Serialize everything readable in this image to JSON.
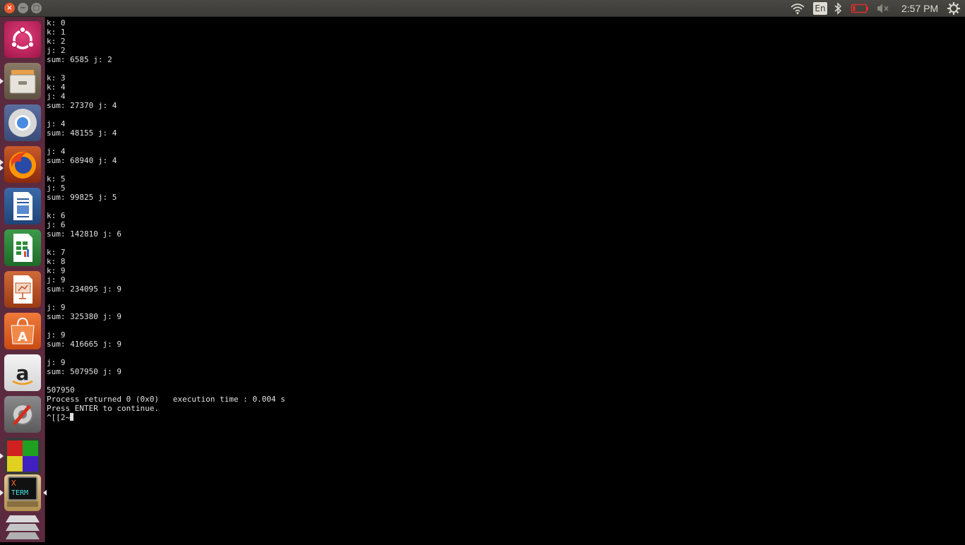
{
  "top_panel": {
    "window_buttons": {
      "close": "×",
      "minimize": "−",
      "maximize": "□"
    },
    "tray": {
      "language": "En",
      "clock": "2:57 PM"
    }
  },
  "launcher": {
    "items": [
      {
        "icon": "ubuntu-dash-icon",
        "color": "#c2185b"
      },
      {
        "icon": "files-icon",
        "color": "#7a6a55"
      },
      {
        "icon": "chromium-icon",
        "color": "#4a7fd6"
      },
      {
        "icon": "firefox-icon",
        "color": "#e66000"
      },
      {
        "icon": "libreoffice-writer-icon",
        "color": "#2a5a9c"
      },
      {
        "icon": "libreoffice-calc-icon",
        "color": "#2e8b3a"
      },
      {
        "icon": "libreoffice-impress-icon",
        "color": "#c0501e"
      },
      {
        "icon": "software-center-icon",
        "color": "#e05a1c"
      },
      {
        "icon": "amazon-icon",
        "color": "#f0f0f0"
      },
      {
        "icon": "system-settings-icon",
        "color": "#9a9a9a"
      },
      {
        "icon": "codeblocks-icon",
        "color": "#6a4aa0"
      },
      {
        "icon": "xterm-icon",
        "color": "#c9b47a"
      },
      {
        "icon": "workspace-switcher-icon",
        "color": "#c8c8c8"
      }
    ]
  },
  "terminal": {
    "lines": [
      "k: 0",
      "k: 1",
      "k: 2",
      "j: 2",
      "sum: 6585 j: 2",
      "",
      "k: 3",
      "k: 4",
      "j: 4",
      "sum: 27370 j: 4",
      "",
      "j: 4",
      "sum: 48155 j: 4",
      "",
      "j: 4",
      "sum: 68940 j: 4",
      "",
      "k: 5",
      "j: 5",
      "sum: 99825 j: 5",
      "",
      "k: 6",
      "j: 6",
      "sum: 142810 j: 6",
      "",
      "k: 7",
      "k: 8",
      "k: 9",
      "j: 9",
      "sum: 234095 j: 9",
      "",
      "j: 9",
      "sum: 325380 j: 9",
      "",
      "j: 9",
      "sum: 416665 j: 9",
      "",
      "j: 9",
      "sum: 507950 j: 9",
      "",
      "507950",
      "Process returned 0 (0x0)   execution time : 0.004 s",
      "Press ENTER to continue."
    ],
    "prompt_line": "^[[2~"
  }
}
